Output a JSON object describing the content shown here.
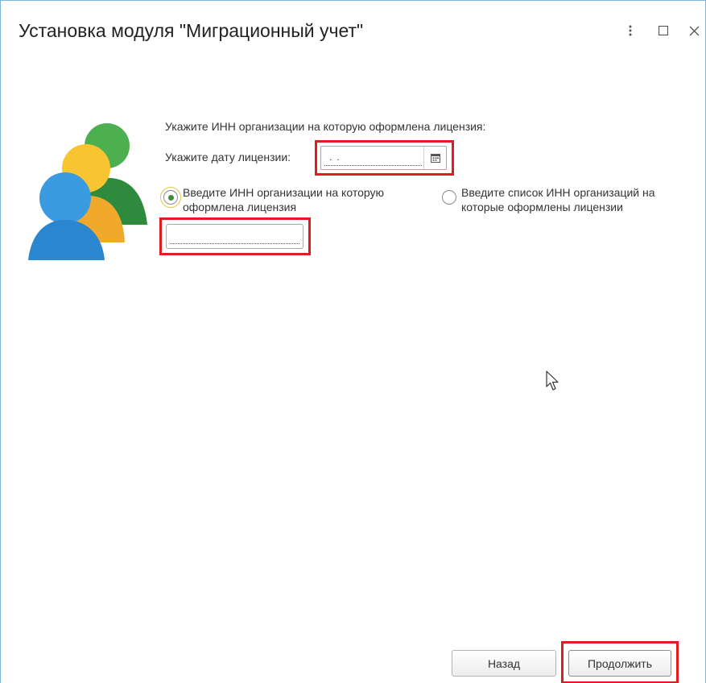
{
  "window": {
    "title": "Установка модуля \"Миграционный учет\"",
    "controls": [
      "more-icon",
      "maximize-icon",
      "close-icon"
    ]
  },
  "form": {
    "inn_prompt": "Укажите ИНН организации на которую оформлена лицензия:",
    "date_label": "Укажите дату лицензии:",
    "date_value": ". .",
    "radio_single": {
      "line1": "Введите ИНН организации на которую",
      "line2": "оформлена лицензия",
      "selected": true
    },
    "radio_list": {
      "line1": "Введите список ИНН организаций на",
      "line2": "которые оформлены лицензии",
      "selected": false
    },
    "inn_value": ""
  },
  "buttons": {
    "back": "Назад",
    "next": "Продолжить"
  },
  "colors": {
    "highlight": "#e21b23",
    "window_border": "#7fb4d6",
    "radio_selected": "#3a8b3a"
  }
}
